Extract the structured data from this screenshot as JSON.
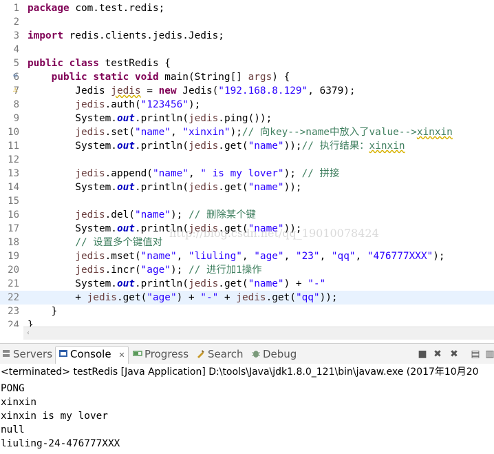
{
  "editor": {
    "lines": [
      {
        "num": "1",
        "segs": [
          {
            "c": "kw",
            "t": "package"
          },
          {
            "t": " com.test.redis;"
          }
        ]
      },
      {
        "num": "2",
        "segs": []
      },
      {
        "num": "3",
        "segs": [
          {
            "c": "kw",
            "t": "import"
          },
          {
            "t": " redis.clients.jedis.Jedis;"
          }
        ]
      },
      {
        "num": "4",
        "segs": []
      },
      {
        "num": "5",
        "segs": [
          {
            "c": "kw",
            "t": "public"
          },
          {
            "t": " "
          },
          {
            "c": "kw",
            "t": "class"
          },
          {
            "t": " testRedis {"
          }
        ]
      },
      {
        "num": "6",
        "segs": [
          {
            "t": "    "
          },
          {
            "c": "kw",
            "t": "public"
          },
          {
            "t": " "
          },
          {
            "c": "kw",
            "t": "static"
          },
          {
            "t": " "
          },
          {
            "c": "kw",
            "t": "void"
          },
          {
            "t": " main(String[] "
          },
          {
            "c": "fld",
            "t": "args"
          },
          {
            "t": ") {"
          }
        ]
      },
      {
        "num": "7",
        "segs": [
          {
            "t": "        Jedis "
          },
          {
            "c": "fld ul",
            "t": "jedis"
          },
          {
            "t": " = "
          },
          {
            "c": "kw",
            "t": "new"
          },
          {
            "t": " Jedis("
          },
          {
            "c": "str",
            "t": "\"192.168.8.129\""
          },
          {
            "t": ", 6379);"
          }
        ]
      },
      {
        "num": "8",
        "segs": [
          {
            "t": "        "
          },
          {
            "c": "fld",
            "t": "jedis"
          },
          {
            "t": ".auth("
          },
          {
            "c": "str",
            "t": "\"123456\""
          },
          {
            "t": ");"
          }
        ]
      },
      {
        "num": "9",
        "segs": [
          {
            "t": "        System."
          },
          {
            "c": "sf",
            "t": "out"
          },
          {
            "t": ".println("
          },
          {
            "c": "fld",
            "t": "jedis"
          },
          {
            "t": ".ping());"
          }
        ]
      },
      {
        "num": "10",
        "segs": [
          {
            "t": "        "
          },
          {
            "c": "fld",
            "t": "jedis"
          },
          {
            "t": ".set("
          },
          {
            "c": "str",
            "t": "\"name\""
          },
          {
            "t": ", "
          },
          {
            "c": "str",
            "t": "\"xinxin\""
          },
          {
            "t": ");"
          },
          {
            "c": "cm",
            "t": "// 向key-->name中放入了value-->"
          },
          {
            "c": "cm ul",
            "t": "xinxin"
          }
        ]
      },
      {
        "num": "11",
        "segs": [
          {
            "t": "        System."
          },
          {
            "c": "sf",
            "t": "out"
          },
          {
            "t": ".println("
          },
          {
            "c": "fld",
            "t": "jedis"
          },
          {
            "t": ".get("
          },
          {
            "c": "str",
            "t": "\"name\""
          },
          {
            "t": "));"
          },
          {
            "c": "cm",
            "t": "// 执行结果："
          },
          {
            "c": "cm ul",
            "t": "xinxin"
          }
        ]
      },
      {
        "num": "12",
        "segs": []
      },
      {
        "num": "13",
        "segs": [
          {
            "t": "        "
          },
          {
            "c": "fld",
            "t": "jedis"
          },
          {
            "t": ".append("
          },
          {
            "c": "str",
            "t": "\"name\""
          },
          {
            "t": ", "
          },
          {
            "c": "str",
            "t": "\" is my lover\""
          },
          {
            "t": "); "
          },
          {
            "c": "cm",
            "t": "// 拼接"
          }
        ]
      },
      {
        "num": "14",
        "segs": [
          {
            "t": "        System."
          },
          {
            "c": "sf",
            "t": "out"
          },
          {
            "t": ".println("
          },
          {
            "c": "fld",
            "t": "jedis"
          },
          {
            "t": ".get("
          },
          {
            "c": "str",
            "t": "\"name\""
          },
          {
            "t": "));"
          }
        ]
      },
      {
        "num": "15",
        "segs": []
      },
      {
        "num": "16",
        "segs": [
          {
            "t": "        "
          },
          {
            "c": "fld",
            "t": "jedis"
          },
          {
            "t": ".del("
          },
          {
            "c": "str",
            "t": "\"name\""
          },
          {
            "t": "); "
          },
          {
            "c": "cm",
            "t": "// 删除某个键"
          }
        ]
      },
      {
        "num": "17",
        "segs": [
          {
            "t": "        System."
          },
          {
            "c": "sf",
            "t": "out"
          },
          {
            "t": ".println("
          },
          {
            "c": "fld",
            "t": "jedis"
          },
          {
            "t": ".get("
          },
          {
            "c": "str",
            "t": "\"name\""
          },
          {
            "t": "));"
          }
        ]
      },
      {
        "num": "18",
        "segs": [
          {
            "t": "        "
          },
          {
            "c": "cm",
            "t": "// 设置多个键值对"
          }
        ]
      },
      {
        "num": "19",
        "segs": [
          {
            "t": "        "
          },
          {
            "c": "fld",
            "t": "jedis"
          },
          {
            "t": ".mset("
          },
          {
            "c": "str",
            "t": "\"name\""
          },
          {
            "t": ", "
          },
          {
            "c": "str",
            "t": "\"liuling\""
          },
          {
            "t": ", "
          },
          {
            "c": "str",
            "t": "\"age\""
          },
          {
            "t": ", "
          },
          {
            "c": "str",
            "t": "\"23\""
          },
          {
            "t": ", "
          },
          {
            "c": "str",
            "t": "\"qq\""
          },
          {
            "t": ", "
          },
          {
            "c": "str",
            "t": "\"476777XXX\""
          },
          {
            "t": ");"
          }
        ]
      },
      {
        "num": "20",
        "segs": [
          {
            "t": "        "
          },
          {
            "c": "fld",
            "t": "jedis"
          },
          {
            "t": ".incr("
          },
          {
            "c": "str",
            "t": "\"age\""
          },
          {
            "t": "); "
          },
          {
            "c": "cm",
            "t": "// 进行加1操作"
          }
        ]
      },
      {
        "num": "21",
        "segs": [
          {
            "t": "        System."
          },
          {
            "c": "sf",
            "t": "out"
          },
          {
            "t": ".println("
          },
          {
            "c": "fld",
            "t": "jedis"
          },
          {
            "t": ".get("
          },
          {
            "c": "str",
            "t": "\"name\""
          },
          {
            "t": ") + "
          },
          {
            "c": "str",
            "t": "\"-\""
          }
        ]
      },
      {
        "num": "22",
        "segs": [
          {
            "t": "        + "
          },
          {
            "c": "fld",
            "t": "jedis"
          },
          {
            "t": ".get("
          },
          {
            "c": "str",
            "t": "\"age\""
          },
          {
            "t": ") + "
          },
          {
            "c": "str",
            "t": "\"-\""
          },
          {
            "t": " + "
          },
          {
            "c": "fld",
            "t": "jedis"
          },
          {
            "t": ".get("
          },
          {
            "c": "str",
            "t": "\"qq\""
          },
          {
            "t": "));"
          }
        ]
      },
      {
        "num": "23",
        "segs": [
          {
            "t": "    }"
          }
        ]
      },
      {
        "num": "24",
        "segs": [
          {
            "t": "}"
          }
        ]
      }
    ],
    "highlight_line": 22,
    "watermark": "http://blog.csdn.net/qq_19010078424"
  },
  "views": {
    "tabs": [
      {
        "label": "Servers",
        "icon": "servers-icon",
        "color": "#7a7a7a"
      },
      {
        "label": "Console",
        "icon": "console-icon",
        "color": "#2e5ea8",
        "active": true
      },
      {
        "label": "Progress",
        "icon": "progress-icon",
        "color": "#5a9a5a"
      },
      {
        "label": "Search",
        "icon": "search-icon",
        "color": "#c89a2a"
      },
      {
        "label": "Debug",
        "icon": "debug-icon",
        "color": "#6a8a6a"
      }
    ],
    "close_glyph": "✕"
  },
  "console": {
    "status": "<terminated> testRedis [Java Application] D:\\tools\\Java\\jdk1.8.0_121\\bin\\javaw.exe (2017年10月20",
    "output": [
      "PONG",
      "xinxin",
      "xinxin is my lover",
      "null",
      "liuling-24-476777XXX"
    ]
  }
}
